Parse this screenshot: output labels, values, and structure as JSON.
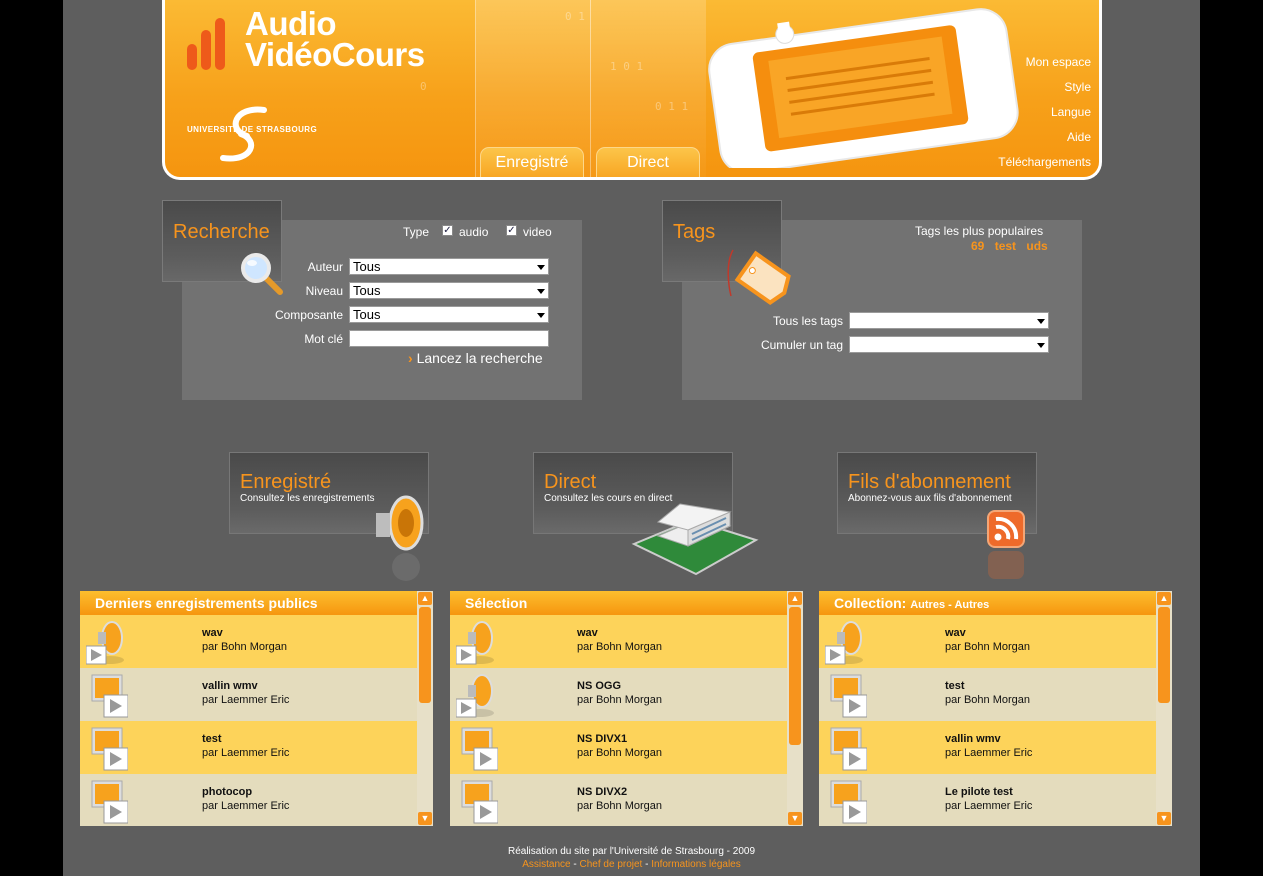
{
  "header": {
    "logo_line1": "Audio",
    "logo_line2": "VidéoCours",
    "university_prefix": "UNIVERSITÉ DE",
    "university_name": "STRASBOURG",
    "tabs": [
      "Enregistré",
      "Direct"
    ],
    "menu": [
      "Mon espace",
      "Style",
      "Langue",
      "Aide",
      "Téléchargements"
    ],
    "colors": {
      "accent": "#f7941d",
      "header_bg": "#f9ab24",
      "page_bg": "#5e5e5e"
    }
  },
  "search": {
    "title": "Recherche",
    "type_label": "Type",
    "audio_label": "audio",
    "video_label": "video",
    "fields": [
      {
        "label": "Auteur",
        "value": "Tous"
      },
      {
        "label": "Niveau",
        "value": "Tous"
      },
      {
        "label": "Composante",
        "value": "Tous"
      }
    ],
    "keyword_label": "Mot clé",
    "keyword_value": "",
    "submit_label": "Lancez la recherche"
  },
  "tags": {
    "title": "Tags",
    "popular_label": "Tags les plus populaires",
    "popular_tags": [
      "69",
      "test",
      "uds"
    ],
    "all_tags_label": "Tous les tags",
    "cumulate_label": "Cumuler un tag"
  },
  "sections": [
    {
      "title": "Enregistré",
      "subtitle": "Consultez les enregistrements",
      "icon": "speaker-icon"
    },
    {
      "title": "Direct",
      "subtitle": "Consultez les cours en direct",
      "icon": "building-icon"
    },
    {
      "title": "Fils d'abonnement",
      "subtitle": "Abonnez-vous aux fils d'abonnement",
      "icon": "rss-icon"
    }
  ],
  "lists": [
    {
      "title": "Derniers enregistrements publics",
      "title_suffix": "",
      "items": [
        {
          "name": "wav",
          "by": "par Bohn Morgan",
          "kind": "audio"
        },
        {
          "name": "vallin wmv",
          "by": "par Laemmer Eric",
          "kind": "video"
        },
        {
          "name": "test",
          "by": "par Laemmer Eric",
          "kind": "video"
        },
        {
          "name": "photocop",
          "by": "par Laemmer Eric",
          "kind": "video"
        }
      ]
    },
    {
      "title": "Sélection",
      "title_suffix": "",
      "items": [
        {
          "name": "wav",
          "by": "par Bohn Morgan",
          "kind": "audio"
        },
        {
          "name": "NS OGG",
          "by": "par Bohn Morgan",
          "kind": "audio"
        },
        {
          "name": "NS DIVX1",
          "by": "par Bohn Morgan",
          "kind": "video"
        },
        {
          "name": "NS DIVX2",
          "by": "par Bohn Morgan",
          "kind": "video"
        }
      ]
    },
    {
      "title": "Collection:",
      "title_suffix": "Autres - Autres",
      "items": [
        {
          "name": "wav",
          "by": "par Bohn Morgan",
          "kind": "audio"
        },
        {
          "name": "test",
          "by": "par Bohn Morgan",
          "kind": "video"
        },
        {
          "name": "vallin wmv",
          "by": "par Laemmer Eric",
          "kind": "video"
        },
        {
          "name": "Le pilote test",
          "by": "par Laemmer Eric",
          "kind": "video"
        }
      ]
    }
  ],
  "footer": {
    "credit": "Réalisation du site par l'Université de Strasbourg - 2009",
    "links": [
      "Assistance",
      "Chef de projet",
      "Informations légales"
    ],
    "separator": " - "
  }
}
